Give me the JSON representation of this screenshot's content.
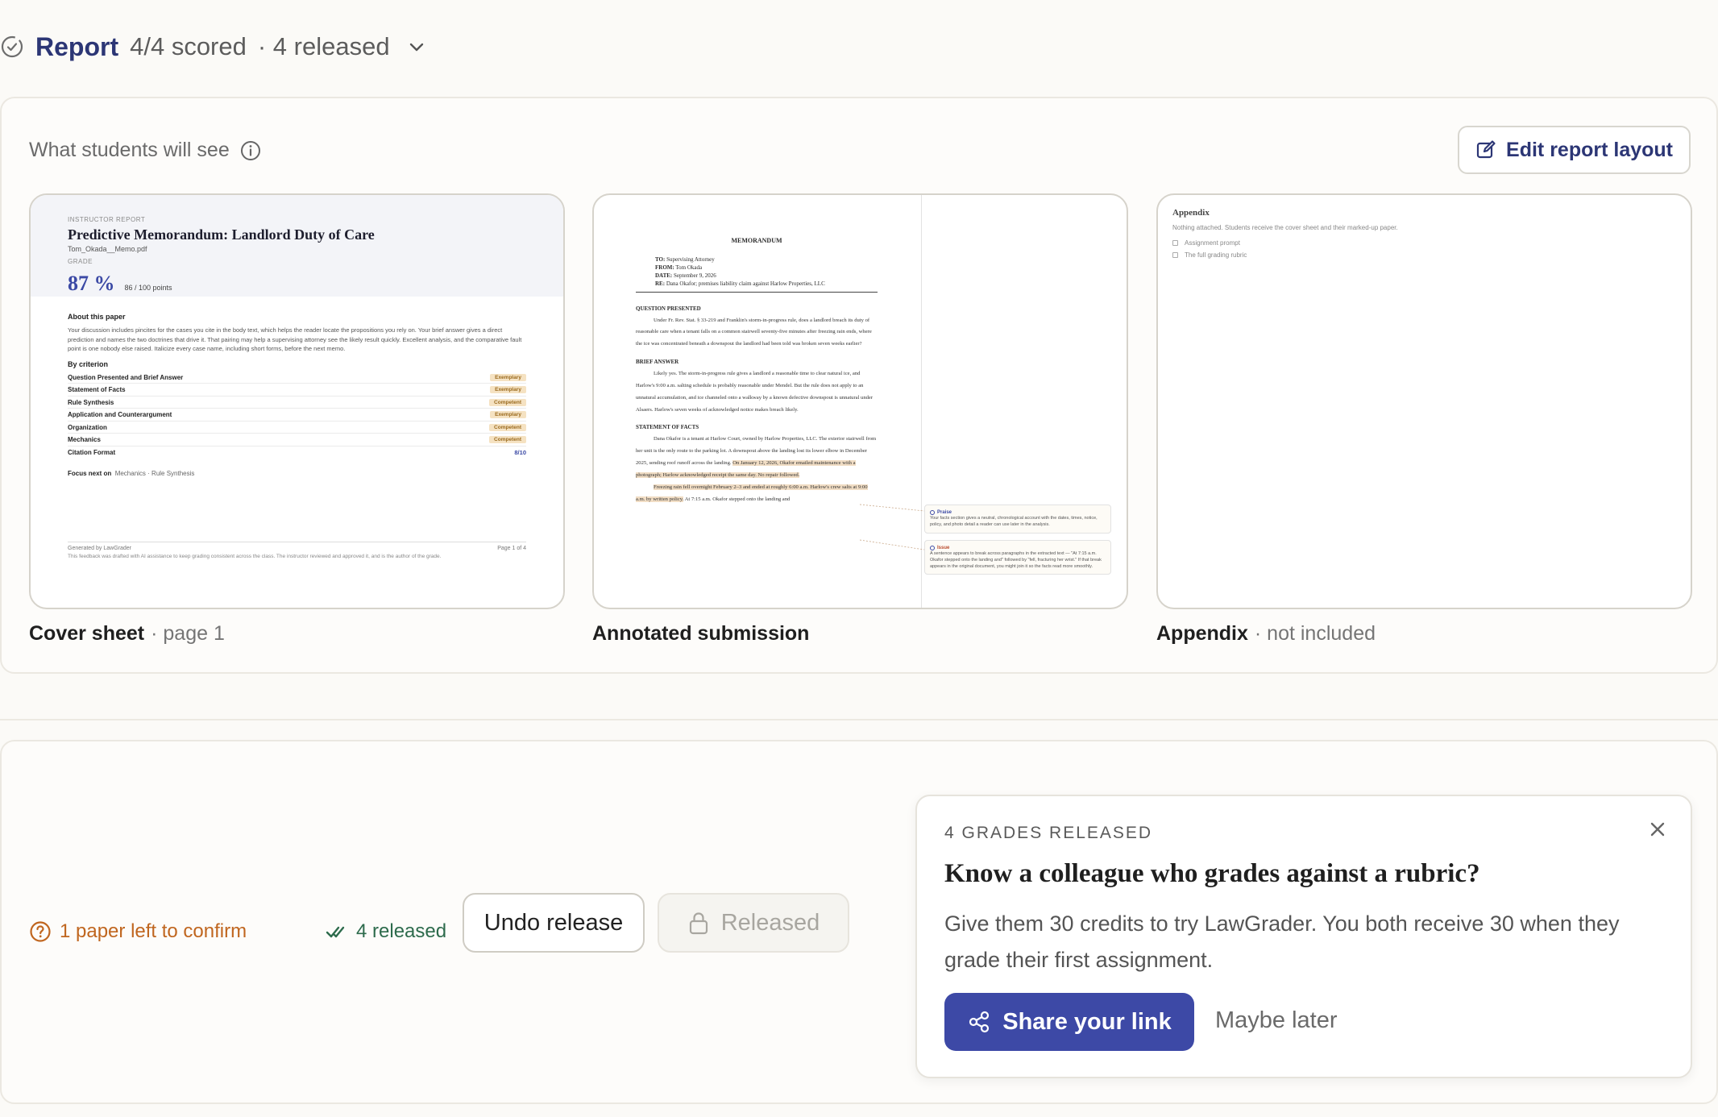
{
  "header": {
    "title": "Report",
    "scored": "4/4 scored",
    "released": "· 4 released"
  },
  "preview": {
    "label": "What students will see",
    "edit_button": "Edit report layout",
    "cards": [
      {
        "name": "Cover sheet",
        "meta": "· page 1"
      },
      {
        "name": "Annotated submission",
        "meta": ""
      },
      {
        "name": "Appendix",
        "meta": "· not included"
      }
    ],
    "cover": {
      "kicker": "INSTRUCTOR REPORT",
      "title": "Predictive Memorandum: Landlord Duty of Care",
      "file": "Tom_Okada__Memo.pdf",
      "grade_label": "GRADE",
      "grade": "87 %",
      "points": "86 / 100 points",
      "about_heading": "About this paper",
      "about_text": "Your discussion includes pincites for the cases you cite in the body text, which helps the reader locate the propositions you rely on. Your brief answer gives a direct prediction and names the two doctrines that drive it. That pairing may help a supervising attorney see the likely result quickly. Excellent analysis, and the comparative fault point is one nobody else raised. Italicize every case name, including short forms, before the next memo.",
      "criterion_heading": "By criterion",
      "criteria": [
        {
          "name": "Question Presented and Brief Answer",
          "level": "Exemplary"
        },
        {
          "name": "Statement of Facts",
          "level": "Exemplary"
        },
        {
          "name": "Rule Synthesis",
          "level": "Competent"
        },
        {
          "name": "Application and Counterargument",
          "level": "Exemplary"
        },
        {
          "name": "Organization",
          "level": "Competent"
        },
        {
          "name": "Mechanics",
          "level": "Competent"
        },
        {
          "name": "Citation Format",
          "level": "8/10"
        }
      ],
      "focus_label": "Focus next on",
      "focus_items": "Mechanics · Rule Synthesis",
      "footer_left": "Generated by LawGrader",
      "footer_right": "Page 1 of 4",
      "footer_note": "This feedback was drafted with AI assistance to keep grading consistent across the class. The instructor reviewed and approved it, and is the author of the grade."
    },
    "annotated": {
      "memo": "MEMORANDUM",
      "to": "Supervising Attorney",
      "from": "Tom Okada",
      "date": "September 9, 2026",
      "re": "Dana Okafor; premises liability claim against Harlow Properties, LLC",
      "qp_heading": "QUESTION PRESENTED",
      "qp_text": "Under Fr. Rev. Stat. § 33-219 and Franklin's storm-in-progress rule, does a landlord breach its duty of reasonable care when a tenant falls on a common stairwell seventy-five minutes after freezing rain ends, where the ice was concentrated beneath a downspout the landlord had been told was broken seven weeks earlier?",
      "ba_heading": "BRIEF ANSWER",
      "ba_text": "Likely yes. The storm-in-progress rule gives a landlord a reasonable time to clear natural ice, and Harlow's 9:00 a.m. salting schedule is probably reasonable under Mendel. But the rule does not apply to an unnatural accumulation, and ice channeled onto a walkway by a known defective downspout is unnatural under Alsaers. Harlow's seven weeks of acknowledged notice makes breach likely.",
      "sof_heading": "STATEMENT OF FACTS",
      "sof_text1": "Dana Okafor is a tenant at Harlow Court, owned by Harlow Properties, LLC. The exterior stairwell from her unit is the only route to the parking lot. A downspout above the landing lost its lower elbow in December 2025, sending roof runoff across the landing.",
      "sof_hl1": "On January 12, 2026, Okafor emailed maintenance with a photograph; Harlow acknowledged receipt the same day. No repair followed.",
      "sof_hl2": "Freezing rain fell overnight February 2–3 and ended at roughly 6:00 a.m. Harlow's crew salts at 9:00 a.m. by written policy.",
      "sof_tail": "At 7:15 a.m. Okafor stepped onto the landing and",
      "note1_tag": "Praise",
      "note1_text": "Your facts section gives a neutral, chronological account with the dates, times, notice, policy, and photo detail a reader can use later in the analysis.",
      "note2_tag": "Issue",
      "note2_text": "A sentence appears to break across paragraphs in the extracted text — \"At 7:15 a.m. Okafor stepped onto the landing and\" followed by \"fell, fracturing her wrist.\" If that break appears in the original document, you might join it so the facts read more smoothly."
    },
    "appendix": {
      "title": "Appendix",
      "note": "Nothing attached. Students receive the cover sheet and their marked-up paper.",
      "items": [
        "Assignment prompt",
        "The full grading rubric"
      ]
    }
  },
  "release": {
    "left_to_confirm": "1 paper left to confirm",
    "released_count": "4 released",
    "undo_button": "Undo release",
    "released_button": "Released"
  },
  "promo": {
    "kicker": "4 GRADES RELEASED",
    "title": "Know a colleague who grades against a rubric?",
    "body": "Give them 30 credits to try LawGrader. You both receive 30 when they grade their first assignment.",
    "share_button": "Share your link",
    "dismiss": "Maybe later"
  },
  "colors": {
    "accent": "#3d49a6",
    "title_navy": "#2c3675",
    "warning": "#c0661f",
    "success": "#2d6b4c",
    "highlight": "#f1ddc4"
  },
  "icons": [
    "check-circle-icon",
    "chevron-down-icon",
    "info-icon",
    "edit-icon",
    "question-circle-icon",
    "double-check-icon",
    "lock-icon",
    "close-icon",
    "share-icon"
  ]
}
